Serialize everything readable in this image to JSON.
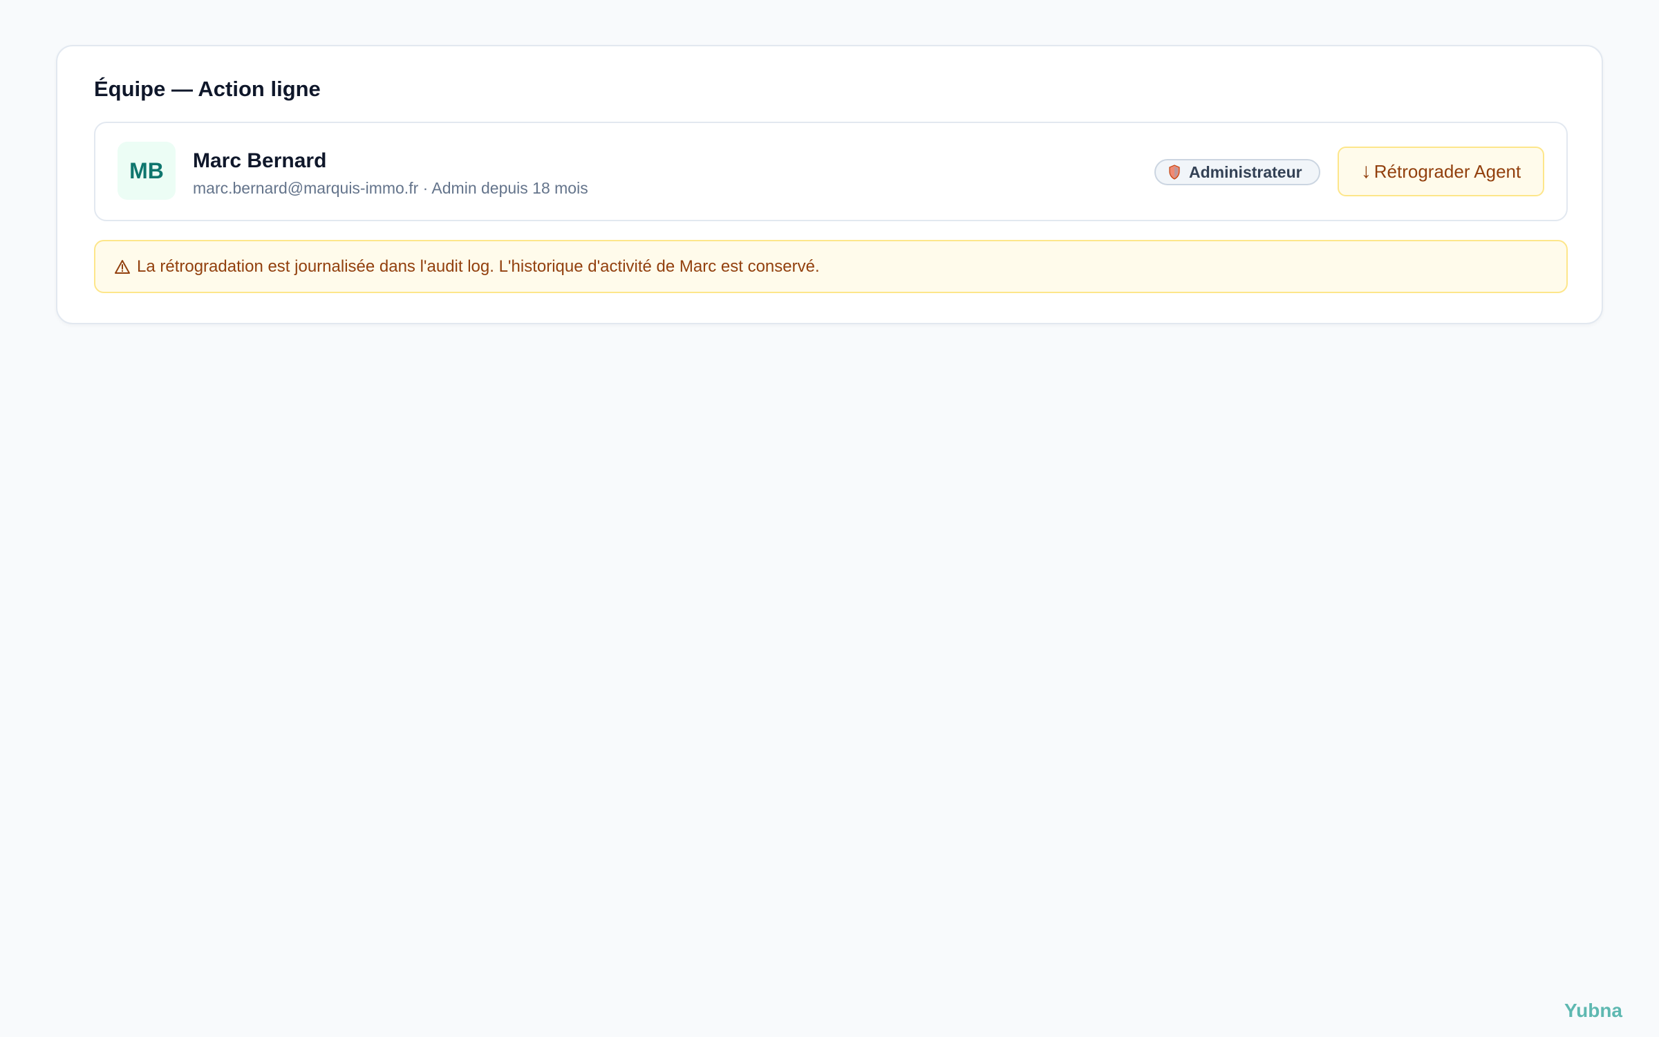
{
  "panel": {
    "title": "Équipe — Action ligne"
  },
  "member": {
    "initials": "MB",
    "name": "Marc Bernard",
    "meta": "marc.bernard@marquis-immo.fr · Admin depuis 18 mois",
    "role_badge": {
      "icon": "shield-icon",
      "label": "Administrateur"
    },
    "action": {
      "arrow": "↓",
      "label": "Rétrograder Agent"
    }
  },
  "warning": {
    "icon": "warning-triangle-icon",
    "text": "La rétrogradation est journalisée dans l'audit log. L'historique d'activité de Marc est conservé."
  },
  "brand": {
    "name": "Yubna"
  },
  "colors": {
    "accent_teal": "#0f766e",
    "avatar_bg": "#ecfdf5",
    "warning_bg": "#fffbeb",
    "warning_border": "#fde68a",
    "warning_text": "#92400e",
    "brand": "#5eb8b1"
  }
}
